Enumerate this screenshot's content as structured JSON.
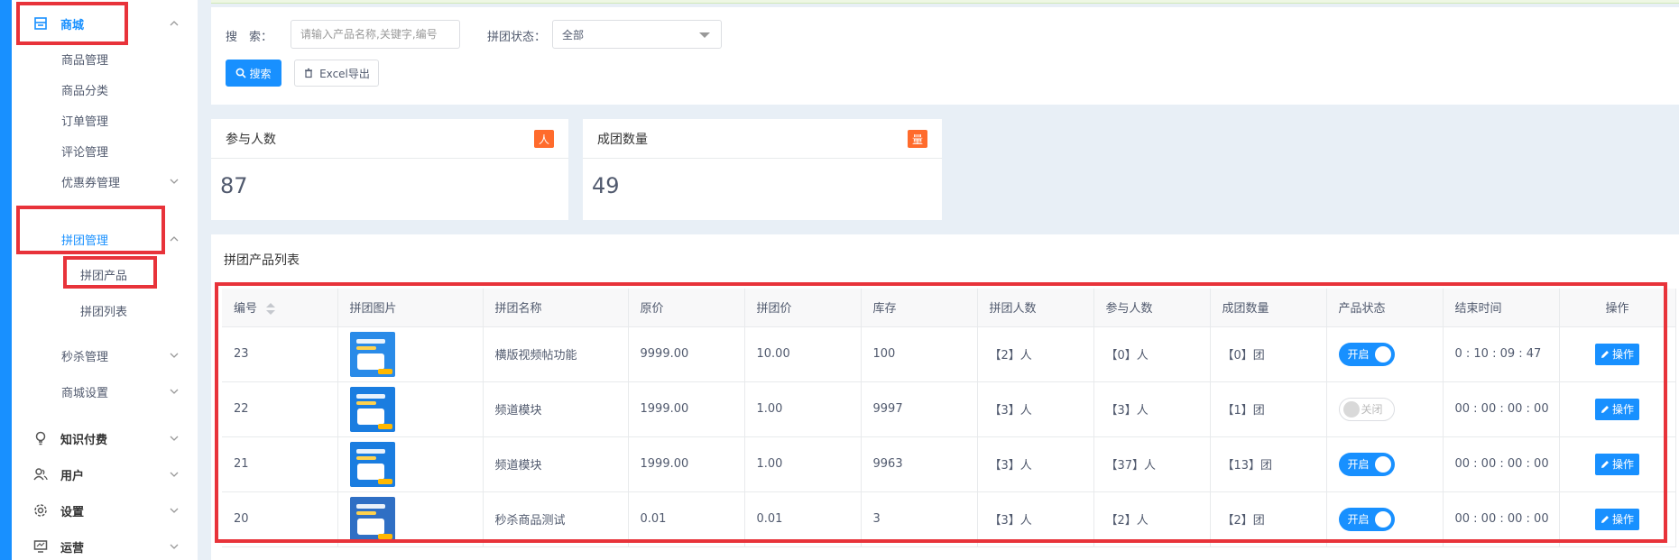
{
  "sidebar": {
    "shop": "商城",
    "product_mgmt": "商品管理",
    "product_cat": "商品分类",
    "order_mgmt": "订单管理",
    "comment_mgmt": "评论管理",
    "coupon_mgmt": "优惠券管理",
    "group_mgmt": "拼团管理",
    "group_products": "拼团产品",
    "group_list": "拼团列表",
    "seckill_mgmt": "秒杀管理",
    "shop_settings": "商城设置",
    "knowledge": "知识付费",
    "users": "用户",
    "settings": "设置",
    "operations": "运营"
  },
  "search": {
    "label": "搜　索：",
    "placeholder": "请输入产品名称,关键字,编号",
    "status_label": "拼团状态：",
    "status_value": "全部",
    "search_btn": "搜索",
    "export_btn": "Excel导出"
  },
  "stats": {
    "participants_title": "参与人数",
    "participants_badge": "人",
    "participants_value": "87",
    "groups_title": "成团数量",
    "groups_badge": "量",
    "groups_value": "49"
  },
  "colors": {
    "accent": "#1890ff",
    "badge_orange": "#ff6b2c",
    "highlight_red": "#e8333a"
  },
  "list": {
    "title": "拼团产品列表",
    "headers": [
      "编号",
      "拼团图片",
      "拼团名称",
      "原价",
      "拼团价",
      "库存",
      "拼团人数",
      "参与人数",
      "成团数量",
      "产品状态",
      "结束时间",
      "操作"
    ],
    "rows": [
      {
        "id": "23",
        "name": "横版视频帖功能",
        "price": "9999.00",
        "group_price": "10.00",
        "stock": "100",
        "group_size": "【2】人",
        "participants": "【0】人",
        "groups": "【0】团",
        "status": "开启",
        "status_on": true,
        "end_time": "0 : 10 : 09 : 47",
        "op": "操作"
      },
      {
        "id": "22",
        "name": "频道模块",
        "price": "1999.00",
        "group_price": "1.00",
        "stock": "9997",
        "group_size": "【3】人",
        "participants": "【3】人",
        "groups": "【1】团",
        "status": "关闭",
        "status_on": false,
        "end_time": "00 : 00 : 00 : 00",
        "op": "操作"
      },
      {
        "id": "21",
        "name": "频道模块",
        "price": "1999.00",
        "group_price": "1.00",
        "stock": "9963",
        "group_size": "【3】人",
        "participants": "【37】人",
        "groups": "【13】团",
        "status": "开启",
        "status_on": true,
        "end_time": "00 : 00 : 00 : 00",
        "op": "操作"
      },
      {
        "id": "20",
        "name": "秒杀商品测试",
        "price": "0.01",
        "group_price": "0.01",
        "stock": "3",
        "group_size": "【3】人",
        "participants": "【2】人",
        "groups": "【2】团",
        "status": "开启",
        "status_on": true,
        "end_time": "00 : 00 : 00 : 00",
        "op": "操作"
      }
    ]
  }
}
